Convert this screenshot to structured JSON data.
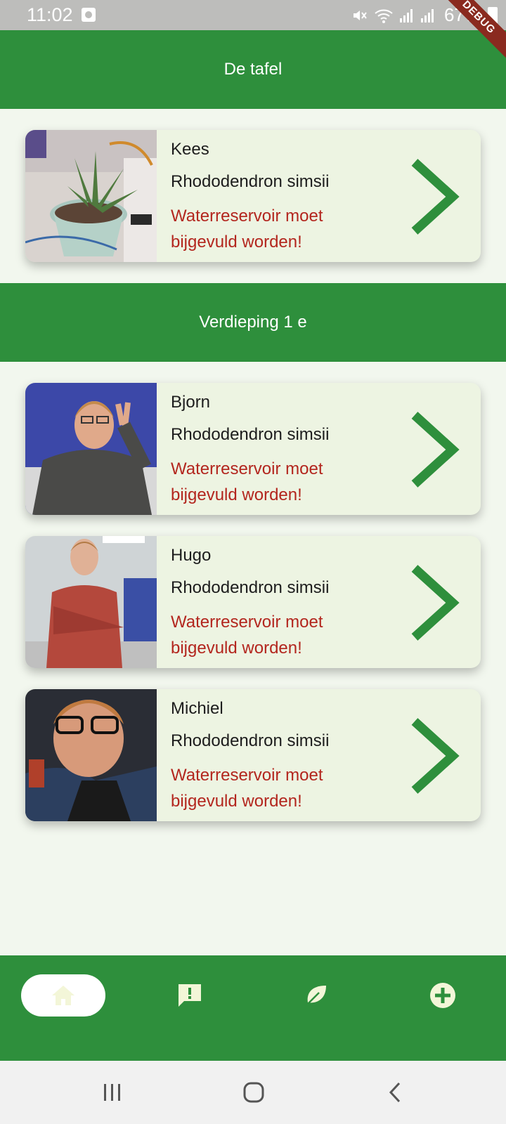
{
  "status_bar": {
    "time": "11:02",
    "battery": "67%"
  },
  "debug_banner": "DEBUG",
  "sections": [
    {
      "title": "De tafel",
      "plants": [
        {
          "name": "Kees",
          "species": "Rhododendron simsii",
          "warning": "Waterreservoir moet bijgevuld worden!"
        }
      ]
    },
    {
      "title": "Verdieping 1 e",
      "plants": [
        {
          "name": "Bjorn",
          "species": "Rhododendron simsii",
          "warning": "Waterreservoir moet bijgevuld worden!"
        },
        {
          "name": "Hugo",
          "species": "Rhododendron simsii",
          "warning": "Waterreservoir moet bijgevuld worden!"
        },
        {
          "name": "Michiel",
          "species": "Rhododendron simsii",
          "warning": "Waterreservoir moet bijgevuld worden!"
        }
      ]
    }
  ],
  "bottom_nav": {
    "items": [
      {
        "icon": "home-icon",
        "active": true
      },
      {
        "icon": "alert-message-icon",
        "active": false
      },
      {
        "icon": "leaf-icon",
        "active": false
      },
      {
        "icon": "add-circle-icon",
        "active": false
      }
    ]
  },
  "system_nav": {
    "items": [
      "recent-apps-icon",
      "home-circle-icon",
      "back-chevron-icon"
    ]
  },
  "colors": {
    "primary_green": "#2e8f3c",
    "card_background": "#edf4e2",
    "page_background": "#f2f7ee",
    "warning_red": "#b3261e",
    "active_nav_icon": "#f3f6d8"
  }
}
